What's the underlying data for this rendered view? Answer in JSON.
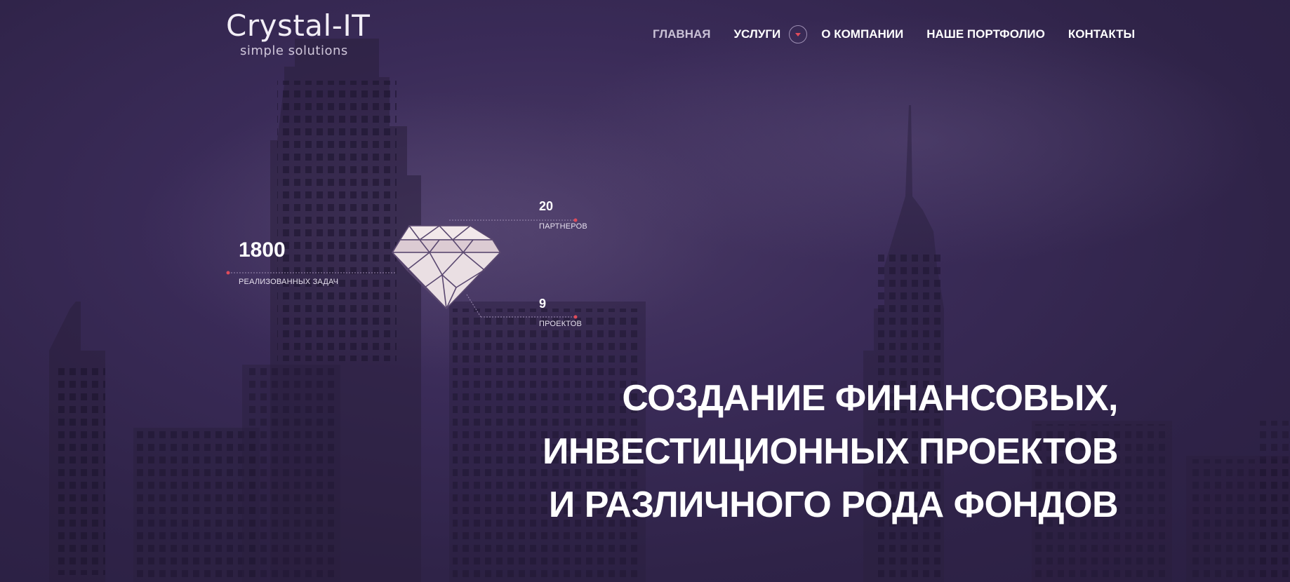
{
  "brand": {
    "title": "Crystal-IT",
    "tagline": "simple solutions"
  },
  "nav": {
    "items": [
      {
        "label": "ГЛАВНАЯ",
        "active": true
      },
      {
        "label": "УСЛУГИ",
        "has_dropdown": true
      },
      {
        "label": "О КОМПАНИИ"
      },
      {
        "label": "НАШЕ ПОРТФОЛИО"
      },
      {
        "label": "КОНТАКТЫ"
      }
    ]
  },
  "stats": {
    "tasks": {
      "value": "1800",
      "label": "РЕАЛИЗОВАННЫХ ЗАДАЧ"
    },
    "partners": {
      "value": "20",
      "label": "ПАРТНЕРОВ"
    },
    "projects": {
      "value": "9",
      "label": "ПРОЕКТОВ"
    }
  },
  "hero": {
    "lines": [
      "СОЗДАНИЕ ФИНАНСОВЫХ,",
      "ИНВЕСТИЦИОННЫХ ПРОЕКТОВ",
      "И РАЗЛИЧНОГО РОДА ФОНДОВ"
    ]
  },
  "colors": {
    "background": "#3a2b58",
    "accent": "#e04b5a",
    "building": "#201830"
  },
  "icons": {
    "dropdown": "chevron-down-icon",
    "diamond": "diamond-icon"
  }
}
